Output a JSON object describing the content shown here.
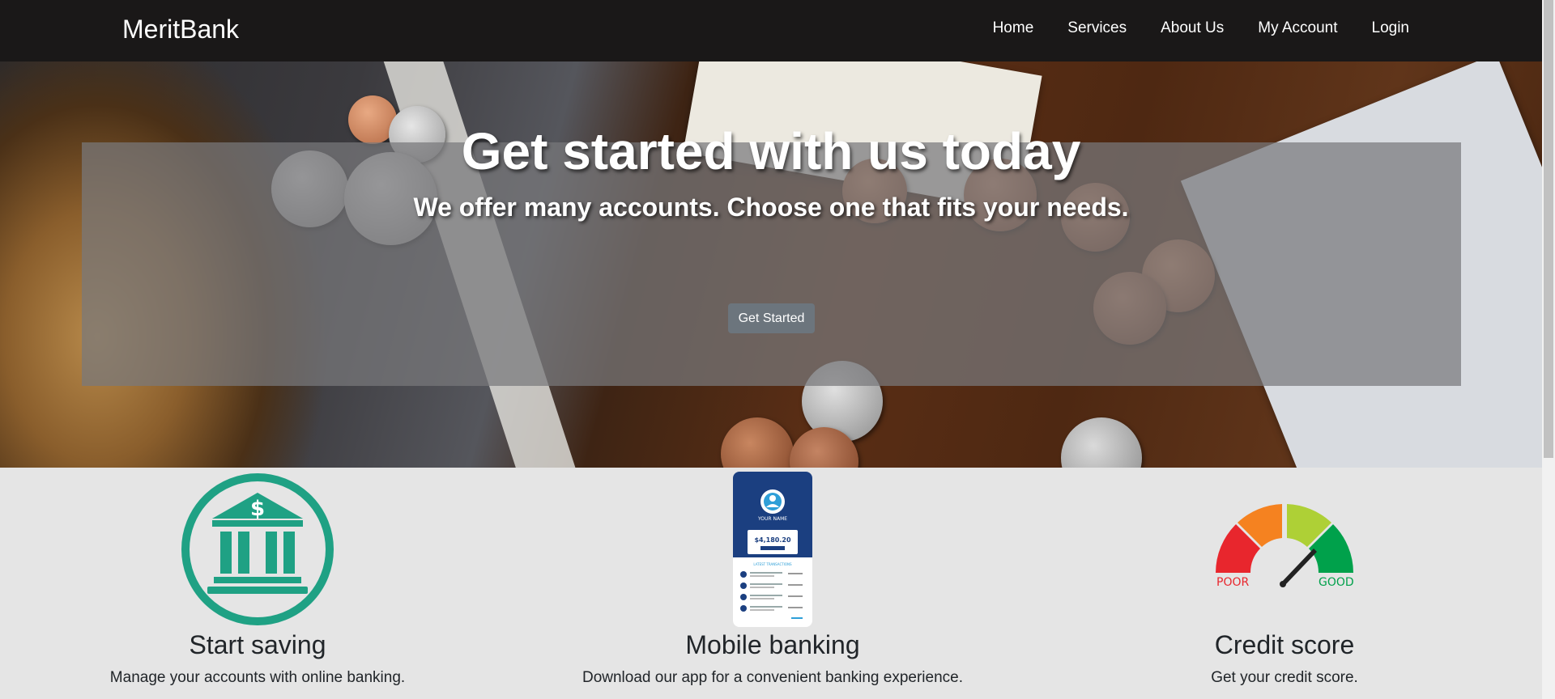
{
  "brand": "MeritBank",
  "nav": {
    "home": "Home",
    "services": "Services",
    "about": "About Us",
    "account": "My Account",
    "login": "Login"
  },
  "hero": {
    "title": "Get started with us today",
    "subtitle": "We offer many accounts. Choose one that fits your needs.",
    "button": "Get Started"
  },
  "features": [
    {
      "title": "Start saving",
      "text": "Manage your accounts with online banking.",
      "icon": "bank-icon"
    },
    {
      "title": "Mobile banking",
      "text": "Download our app for a convenient banking experience.",
      "icon": "mobile-app-icon"
    },
    {
      "title": "Credit score",
      "text": "Get your credit score.",
      "icon": "credit-gauge-icon"
    }
  ],
  "phone": {
    "name": "YOUR NAME",
    "balance": "$4,180.20",
    "section": "LATEST TRANSACTIONS"
  },
  "gauge": {
    "poor": "POOR",
    "good": "GOOD"
  },
  "colors": {
    "navbar": "#1a1818",
    "accent_teal": "#1fa184",
    "button": "#6c757d"
  }
}
